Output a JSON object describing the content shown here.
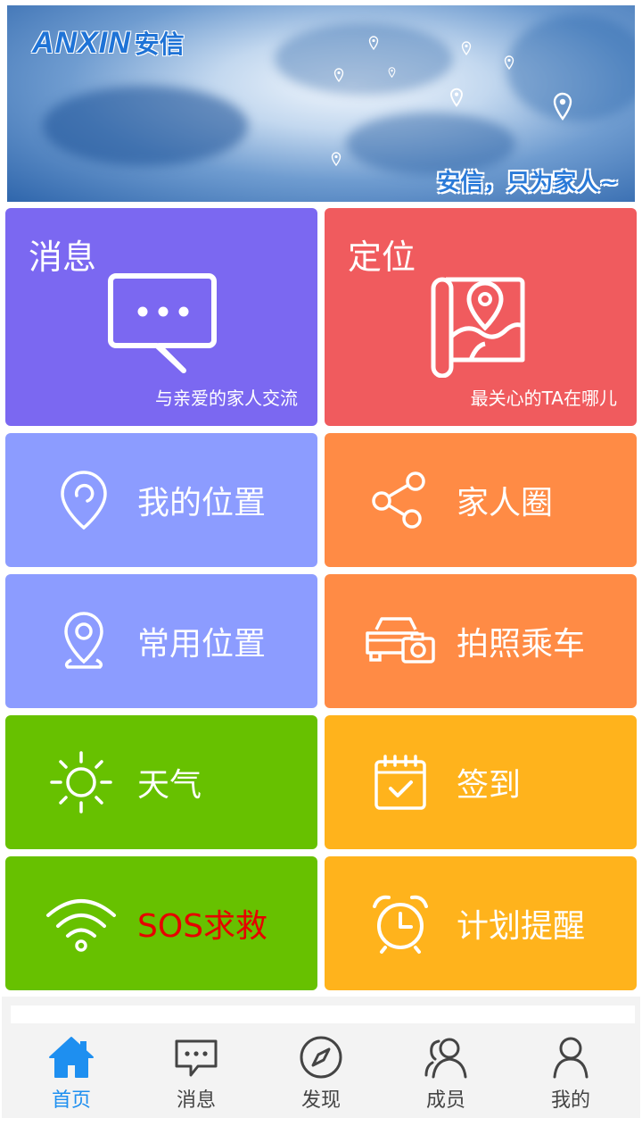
{
  "banner": {
    "logo_en": "ANXIN",
    "logo_cn": "安信",
    "slogan": "安信，只为家人~"
  },
  "tiles": {
    "message": {
      "title": "消息",
      "subtitle": "与亲爱的家人交流",
      "icon": "chat-bubble-icon",
      "color": "#7b68f1"
    },
    "location": {
      "title": "定位",
      "subtitle": "最关心的TA在哪儿",
      "icon": "map-pin-icon",
      "color": "#f05b5e"
    },
    "my_position": {
      "label": "我的位置",
      "icon": "location-pin-icon",
      "color": "#8c9cff"
    },
    "family_circle": {
      "label": "家人圈",
      "icon": "share-icon",
      "color": "#ff8b45"
    },
    "common_position": {
      "label": "常用位置",
      "icon": "location-marker-icon",
      "color": "#8c9cff"
    },
    "photo_ride": {
      "label": "拍照乘车",
      "icon": "car-camera-icon",
      "color": "#ff8b45"
    },
    "weather": {
      "label": "天气",
      "icon": "sun-icon",
      "color": "#67c100"
    },
    "checkin": {
      "label": "签到",
      "icon": "calendar-check-icon",
      "color": "#ffb31c"
    },
    "sos": {
      "label": "SOS求救",
      "icon": "wifi-signal-icon",
      "color": "#67c100",
      "label_color": "#e60000"
    },
    "plan_reminder": {
      "label": "计划提醒",
      "icon": "alarm-clock-icon",
      "color": "#ffb31c"
    }
  },
  "tabbar": {
    "items": [
      {
        "label": "首页",
        "icon": "home-icon",
        "active": true
      },
      {
        "label": "消息",
        "icon": "message-icon",
        "active": false
      },
      {
        "label": "发现",
        "icon": "compass-icon",
        "active": false
      },
      {
        "label": "成员",
        "icon": "members-icon",
        "active": false
      },
      {
        "label": "我的",
        "icon": "profile-icon",
        "active": false
      }
    ],
    "active_color": "#1e8ff0"
  }
}
